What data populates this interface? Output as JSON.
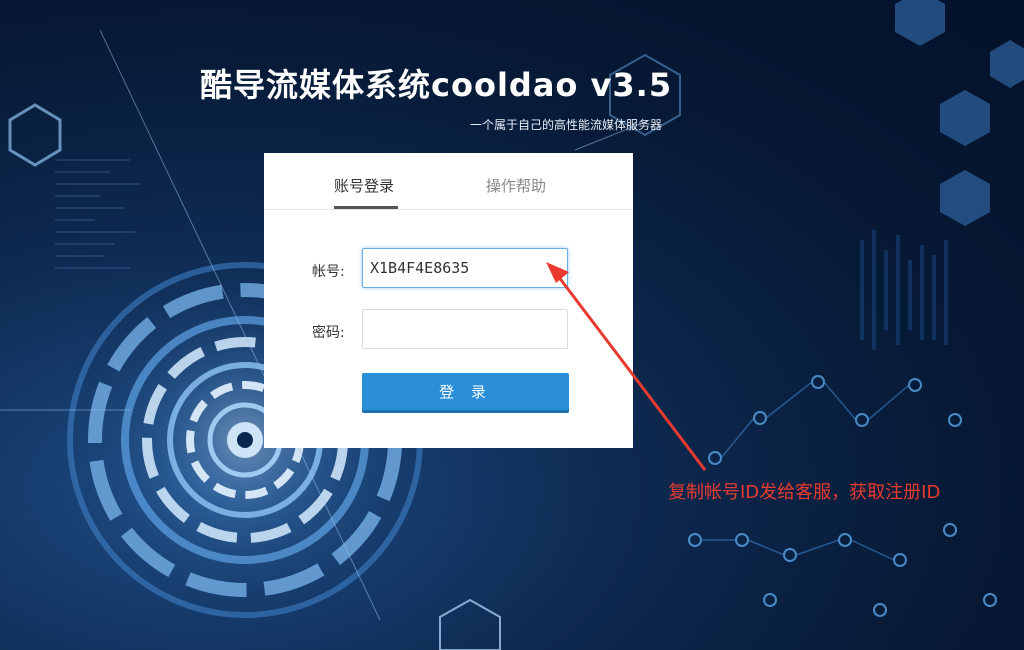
{
  "header": {
    "title": "酷导流媒体系统cooldao v3.5",
    "subtitle": "一个属于自己的高性能流媒体服务器"
  },
  "login": {
    "tabs": [
      {
        "label": "账号登录",
        "active": true
      },
      {
        "label": "操作帮助",
        "active": false
      }
    ],
    "account_label": "帐号:",
    "account_value": "X1B4F4E8635",
    "password_label": "密码:",
    "password_value": "",
    "submit_label": "登 录"
  },
  "annotation": {
    "text": "复制帐号ID发给客服，获取注册ID",
    "color": "#e83a2e"
  },
  "colors": {
    "accent": "#2b8fd8",
    "background": "#071a36"
  }
}
